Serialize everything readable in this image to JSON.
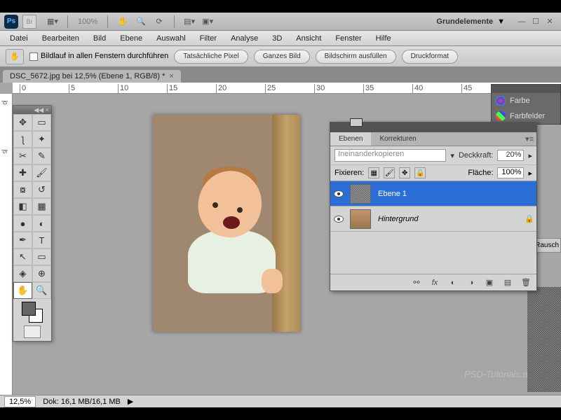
{
  "titlebar": {
    "zoom": "100%",
    "workspace": "Grundelemente"
  },
  "menubar": [
    "Datei",
    "Bearbeiten",
    "Bild",
    "Ebene",
    "Auswahl",
    "Filter",
    "Analyse",
    "3D",
    "Ansicht",
    "Fenster",
    "Hilfe"
  ],
  "optionsbar": {
    "scroll_label": "Bildlauf in allen Fenstern durchführen",
    "buttons": [
      "Tatsächliche Pixel",
      "Ganzes Bild",
      "Bildschirm ausfüllen",
      "Druckformat"
    ]
  },
  "doctab": {
    "title": "DSC_5672.jpg bei 12,5% (Ebene 1, RGB/8) *"
  },
  "ruler_h": [
    "0",
    "5",
    "10",
    "15",
    "20",
    "25",
    "30",
    "35",
    "40",
    "45"
  ],
  "ruler_v": [
    "0",
    "5"
  ],
  "right_panels": {
    "farbe": "Farbe",
    "farbfelder": "Farbfelder",
    "rausch": "Rausch"
  },
  "layers": {
    "tab_layers": "Ebenen",
    "tab_adjust": "Korrekturen",
    "blendmode": "Ineinanderkopieren",
    "opacity_label": "Deckkraft:",
    "opacity": "20%",
    "lock_label": "Fixieren:",
    "fill_label": "Fläche:",
    "fill": "100%",
    "items": [
      {
        "name": "Ebene 1",
        "locked": false,
        "selected": true
      },
      {
        "name": "Hintergrund",
        "locked": true,
        "selected": false
      }
    ]
  },
  "status": {
    "zoom": "12,5%",
    "doc": "Dok: 16,1 MB/16,1 MB"
  },
  "watermark": "PSD-Tutorials.de"
}
